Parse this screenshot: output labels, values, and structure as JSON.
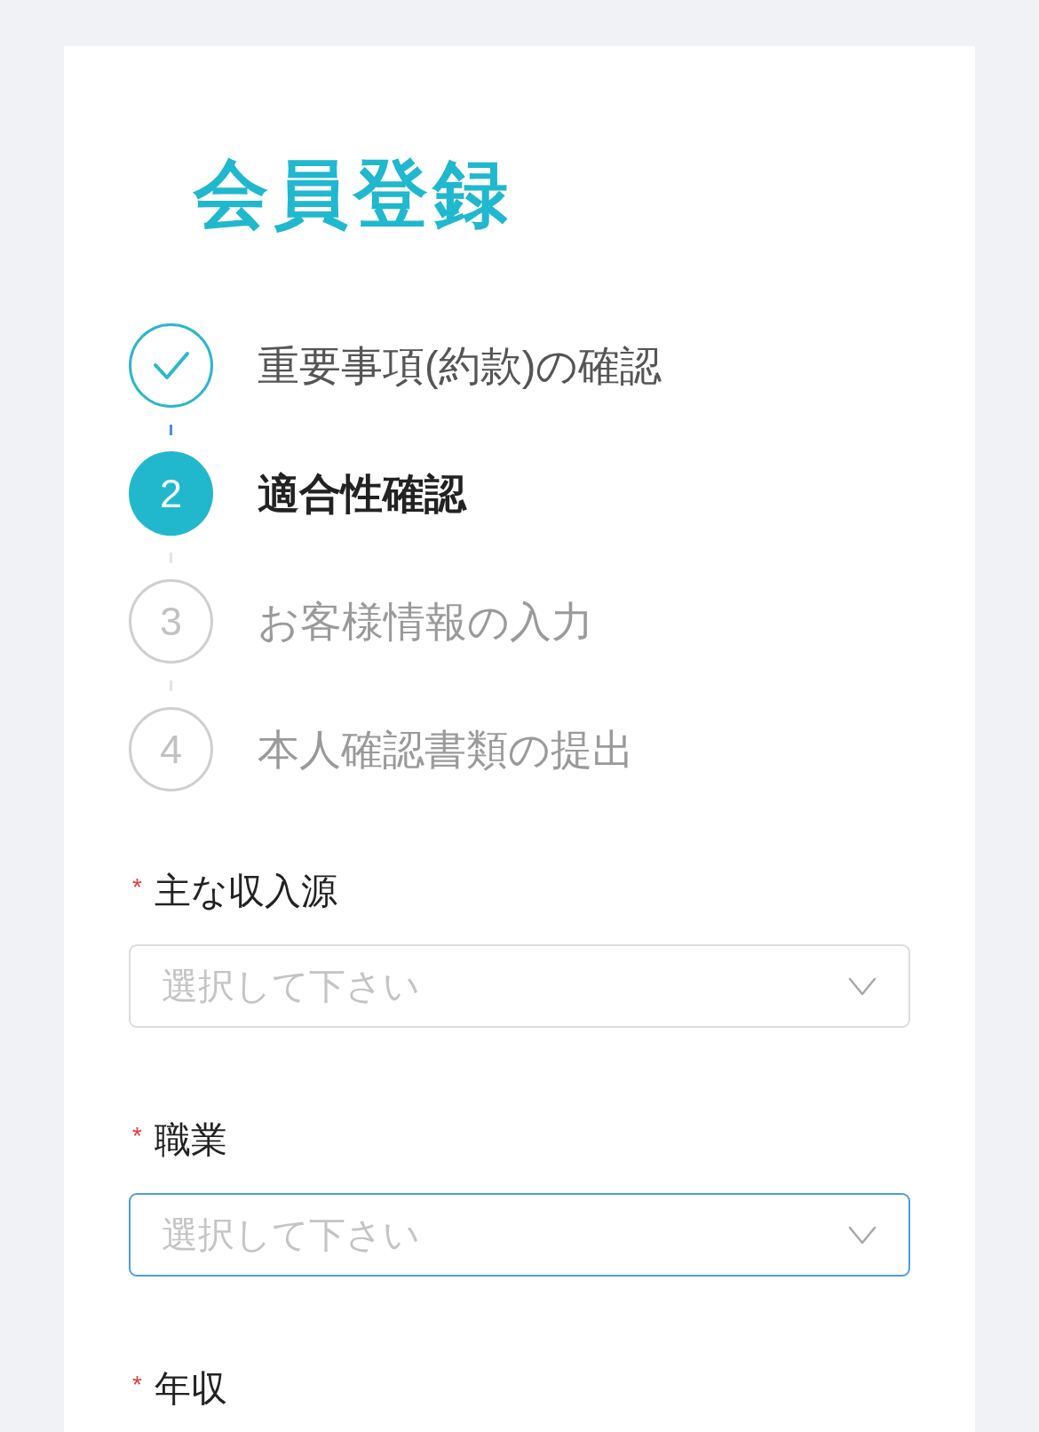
{
  "title": "会員登録",
  "steps": [
    {
      "completed": true,
      "selected": false,
      "label": "重要事項(約款)の確認"
    },
    {
      "completed": false,
      "selected": true,
      "number": "2",
      "label": "適合性確認"
    },
    {
      "completed": false,
      "selected": false,
      "number": "3",
      "label": "お客様情報の入力"
    },
    {
      "completed": false,
      "selected": false,
      "number": "4",
      "label": "本人確認書類の提出"
    }
  ],
  "fields": [
    {
      "required_mark": "*",
      "label": "主な収入源",
      "placeholder": "選択して下さい",
      "focused": false
    },
    {
      "required_mark": "*",
      "label": "職業",
      "placeholder": "選択して下さい",
      "focused": true
    },
    {
      "required_mark": "*",
      "label": "年収"
    }
  ]
}
